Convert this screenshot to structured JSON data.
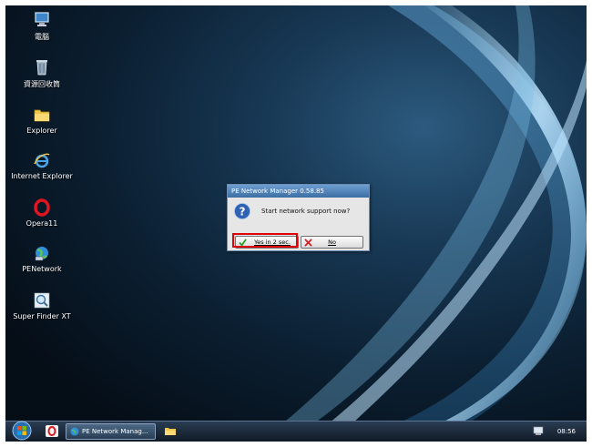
{
  "desktop": {
    "icons": [
      {
        "label": "電腦",
        "icon": "computer-icon"
      },
      {
        "label": "資源回收筒",
        "icon": "recycle-bin-icon"
      },
      {
        "label": "Explorer",
        "icon": "folder-icon"
      },
      {
        "label": "Internet Explorer",
        "icon": "internet-explorer-icon"
      },
      {
        "label": "Opera11",
        "icon": "opera-icon"
      },
      {
        "label": "PENetwork",
        "icon": "network-globe-icon"
      },
      {
        "label": "Super Finder XT",
        "icon": "magnifier-icon"
      }
    ]
  },
  "dialog": {
    "title": "PE Network Manager 0.58.85",
    "message": "Start network support now?",
    "icon": "question-icon",
    "yes_label": "Yes in 2 sec.",
    "no_label": "No"
  },
  "taskbar": {
    "task_button": "PE Network Manag...",
    "clock": "08:56"
  },
  "colors": {
    "highlight": "#e00000",
    "desktop_bg": "#0b1f31"
  }
}
